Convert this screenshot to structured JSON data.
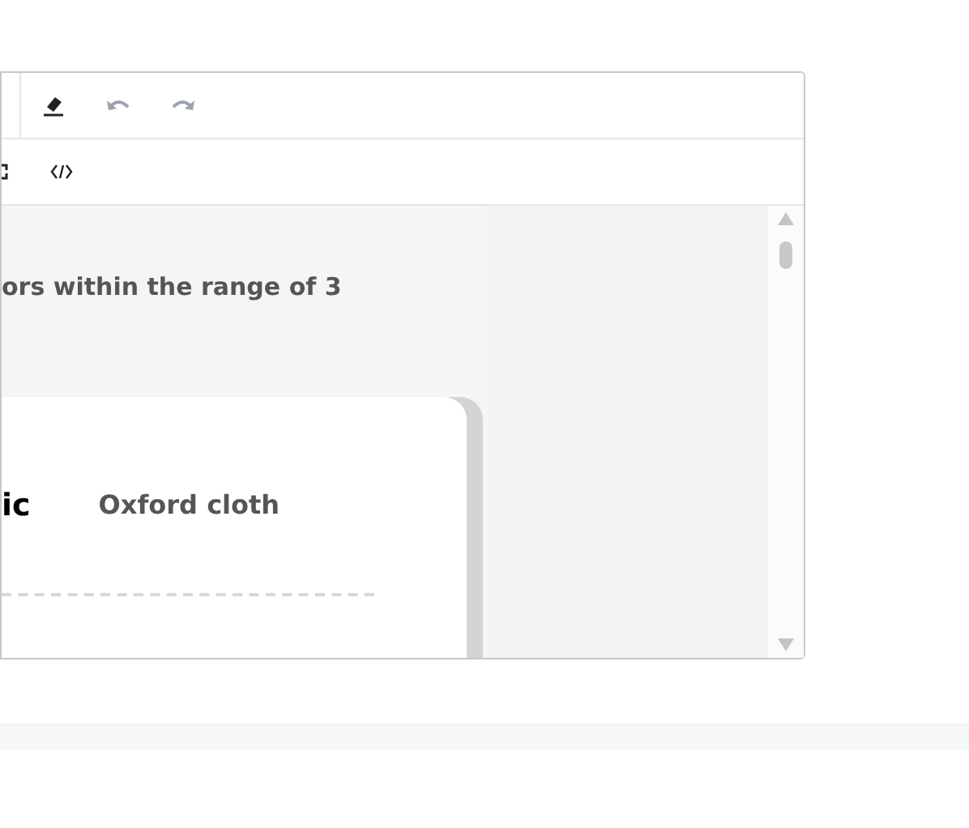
{
  "toolbar": {
    "row_1": [
      {
        "kind": "eraser",
        "disabled": false
      },
      {
        "kind": "undo",
        "disabled": true
      },
      {
        "kind": "redo",
        "disabled": true
      }
    ],
    "row_2": [
      {
        "kind": "cut-off",
        "disabled": false
      },
      {
        "kind": "code",
        "disabled": false
      }
    ]
  },
  "content": {
    "heading": "ors within the range of 3",
    "card": {
      "label": "ic",
      "value": "Oxford cloth"
    }
  }
}
